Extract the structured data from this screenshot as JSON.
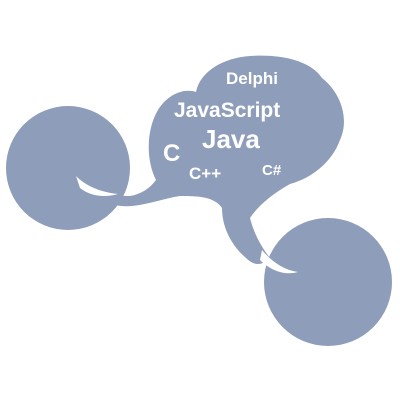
{
  "colors": {
    "shape": "#8e9db9",
    "text": "#ffffff",
    "background": "#ffffff"
  },
  "languages": {
    "delphi": "Delphi",
    "javascript": "JavaScript",
    "java": "Java",
    "c": "C",
    "cpp": "C++",
    "csharp": "C#"
  }
}
